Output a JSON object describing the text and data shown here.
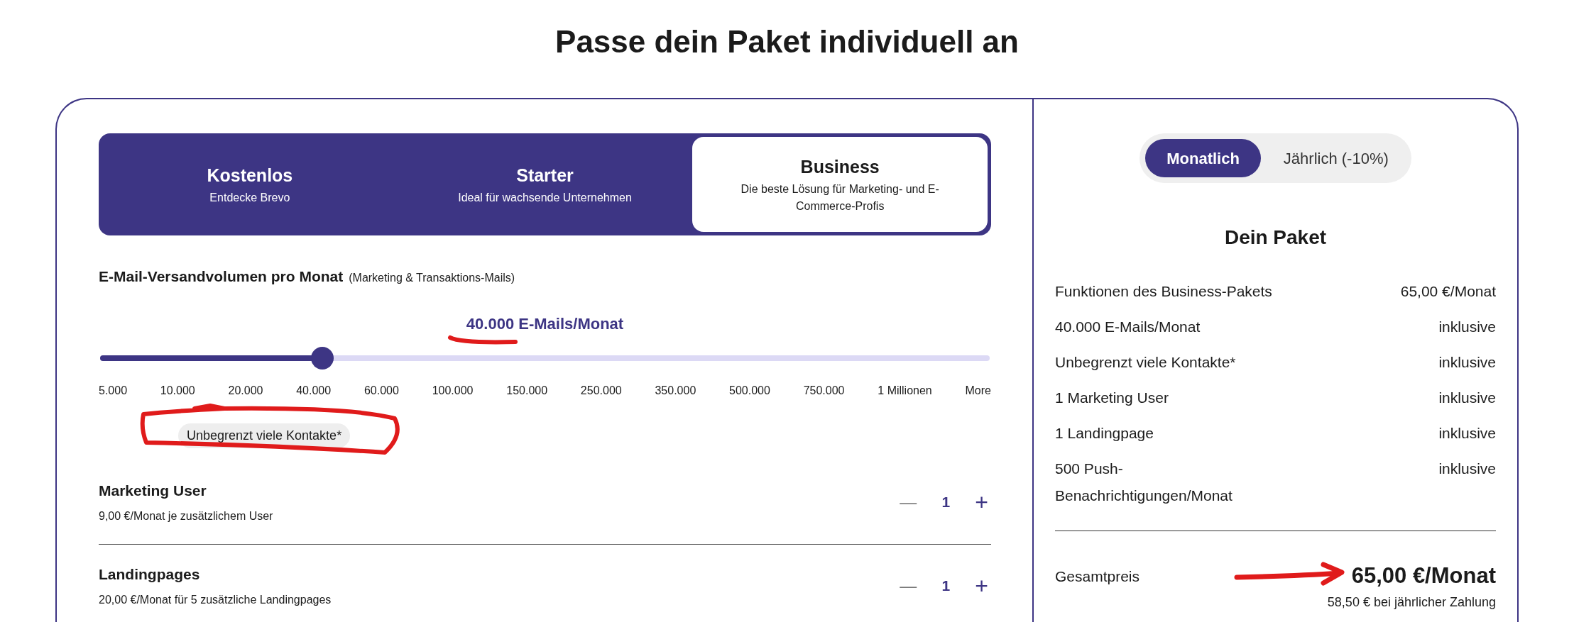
{
  "title": "Passe dein Paket individuell an",
  "plans": [
    {
      "name": "Kostenlos",
      "description": "Entdecke Brevo",
      "selected": false
    },
    {
      "name": "Starter",
      "description": "Ideal für wachsende Unternehmen",
      "selected": false
    },
    {
      "name": "Business",
      "description": "Die beste Lösung für Marketing- und E-Commerce-Profis",
      "selected": true
    }
  ],
  "email_volume": {
    "label": "E-Mail-Versandvolumen pro Monat",
    "note": "(Marketing & Transaktions-Mails)",
    "value": "40.000",
    "unit": "E-Mails/Monat",
    "level": 0.25,
    "ticks": [
      "5.000",
      "10.000",
      "20.000",
      "40.000",
      "60.000",
      "100.000",
      "150.000",
      "250.000",
      "350.000",
      "500.000",
      "750.000",
      "1 Millionen",
      "More"
    ],
    "badge": "Unbegrenzt viele Kontakte*"
  },
  "addons": [
    {
      "name": "Marketing User",
      "price": "9,00 €/Monat je zusätzlichem User",
      "minus": "—",
      "count": "1",
      "plus": "+"
    },
    {
      "name": "Landingpages",
      "price": "20,00 €/Monat für 5 zusätzliche Landingpages",
      "minus": "—",
      "count": "1",
      "plus": "+"
    }
  ],
  "billing": [
    {
      "label": "Monatlich",
      "selected": true
    },
    {
      "label": "Jährlich (-10%)",
      "selected": false
    }
  ],
  "summary": {
    "title": "Dein Paket",
    "rows": [
      {
        "item": "Funktionen des Business-Pakets",
        "price": "65,00 €/Monat"
      },
      {
        "item": "40.000 E-Mails/Monat",
        "price": "inklusive"
      },
      {
        "item": "Unbegrenzt viele Kontakte*",
        "price": "inklusive"
      },
      {
        "item": "1 Marketing User",
        "price": "inklusive"
      },
      {
        "item": "1 Landingpage",
        "price": "inklusive"
      },
      {
        "item": "500 Push-Benachrichtigungen/Monat",
        "price": "inklusive"
      }
    ],
    "total_label": "Gesamtpreis",
    "total": "65,00 €/Monat",
    "yearly_note": "58,50 € bei jährlicher Zahlung"
  }
}
